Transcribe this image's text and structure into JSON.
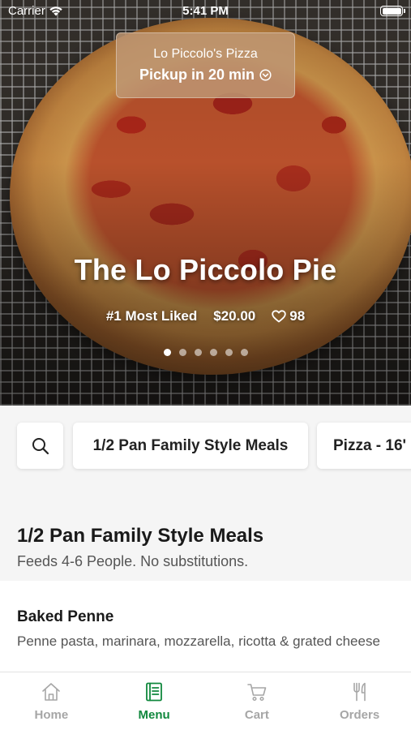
{
  "status_bar": {
    "carrier": "Carrier",
    "time": "5:41 PM"
  },
  "store": {
    "name": "Lo Piccolo's Pizza",
    "pickup": "Pickup in 20 min"
  },
  "featured": {
    "title": "The Lo Piccolo Pie",
    "rank": "#1 Most Liked",
    "price": "$20.00",
    "likes": "98",
    "slide_count": 6,
    "active_slide": 1
  },
  "categories": {
    "items": [
      "1/2 Pan Family Style Meals",
      "Pizza - 16'"
    ]
  },
  "section": {
    "title": "1/2 Pan Family Style Meals",
    "subtitle": "Feeds 4-6 People. No substitutions."
  },
  "menu_items": [
    {
      "name": "Baked Penne",
      "description": "Penne pasta, marinara, mozzarella, ricotta & grated cheese"
    }
  ],
  "tabs": [
    {
      "label": "Home",
      "icon": "home-icon",
      "active": false
    },
    {
      "label": "Menu",
      "icon": "menu-book-icon",
      "active": true
    },
    {
      "label": "Cart",
      "icon": "cart-icon",
      "active": false
    },
    {
      "label": "Orders",
      "icon": "fork-knife-icon",
      "active": false
    }
  ],
  "colors": {
    "accent": "#11883e",
    "inactive": "#a6a6a6",
    "pill": "#be9673"
  }
}
